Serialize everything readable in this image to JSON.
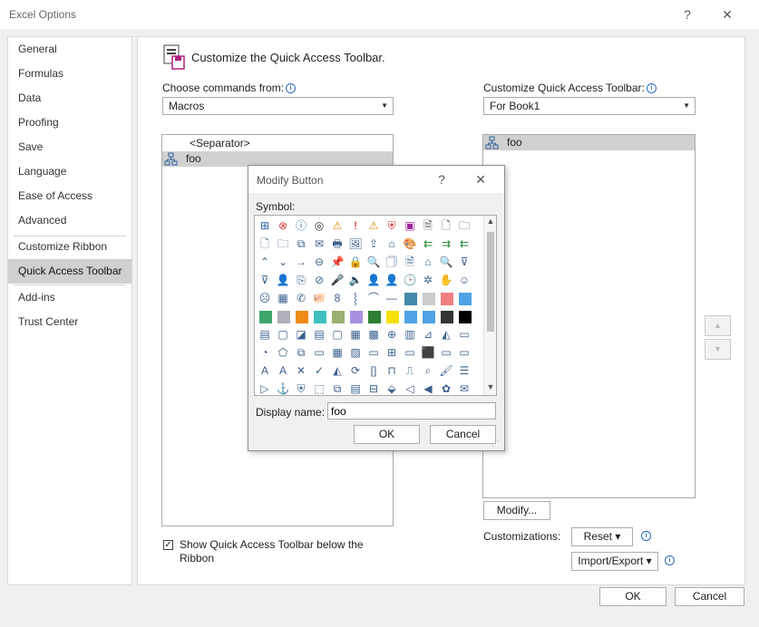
{
  "window": {
    "title": "Excel Options",
    "help_glyph": "?",
    "close_glyph": "✕"
  },
  "nav": {
    "items": [
      {
        "label": "General"
      },
      {
        "label": "Formulas"
      },
      {
        "label": "Data"
      },
      {
        "label": "Proofing"
      },
      {
        "label": "Save"
      },
      {
        "label": "Language"
      },
      {
        "label": "Ease of Access"
      },
      {
        "label": "Advanced"
      },
      {
        "label": "Customize Ribbon"
      },
      {
        "label": "Quick Access Toolbar",
        "selected": true
      },
      {
        "label": "Add-ins"
      },
      {
        "label": "Trust Center"
      }
    ]
  },
  "main": {
    "heading": "Customize the Quick Access Toolbar.",
    "choose_label": "Choose commands from:",
    "choose_value": "Macros",
    "customize_label": "Customize Quick Access Toolbar:",
    "customize_value": "For Book1",
    "commands": [
      {
        "label": "<Separator>",
        "icon": ""
      },
      {
        "label": "foo",
        "icon": "macro-icon",
        "selected": true
      }
    ],
    "toolbar_items": [
      {
        "label": "foo",
        "icon": "macro-icon",
        "selected": true
      }
    ],
    "modify_button": "Modify...",
    "customizations_label": "Customizations:",
    "reset_button": "Reset ▾",
    "import_export_button": "Import/Export ▾",
    "show_below_label_1": "Show Quick Access Toolbar below the",
    "show_below_label_2": "Ribbon",
    "show_below_checked": true,
    "move_up_glyph": "▲",
    "move_down_glyph": "▼"
  },
  "footer": {
    "ok": "OK",
    "cancel": "Cancel"
  },
  "modal": {
    "title": "Modify Button",
    "help_glyph": "?",
    "close_glyph": "✕",
    "symbol_label": "Symbol:",
    "display_name_label": "Display name:",
    "display_name_value": "foo",
    "ok": "OK",
    "cancel": "Cancel",
    "symbols": [
      "⊞",
      "⊗",
      "ⓘ",
      "◎",
      "⚠",
      "!",
      "⚠",
      "⛨",
      "▣",
      "🗎",
      "🗋",
      "🗀",
      "🗋",
      "🗀",
      "⧉",
      "✉",
      "🖶",
      "🖼",
      "⇪",
      "⌂",
      "🎨",
      "⇇",
      "⇉",
      "⇇",
      "⌃",
      "⌄",
      "→",
      "⊖",
      "📌",
      "🔒",
      "🔍",
      "🗍",
      "🗎",
      "⌂",
      "🔍",
      "⊽",
      "⊽",
      "👤",
      "⎘",
      "⊘",
      "🎤",
      "🔈",
      "👤",
      "👤",
      "🕒",
      "✲",
      "✋",
      "☺",
      "☹",
      "▦",
      "✆",
      "🐖",
      "8",
      "⸾",
      "⌒",
      "—",
      "#48a",
      "#ccc",
      "#f08080",
      "#4da3e6",
      "#3fa66b",
      "#b0b0b8",
      "#f08b17",
      "#3fbfbf",
      "#9bb070",
      "#a890e0",
      "#2e7d32",
      "#f5e000",
      "#4da3e6",
      "#4da3e6",
      "#333",
      "#000",
      "▤",
      "▢",
      "◪",
      "▤",
      "▢",
      "▦",
      "▩",
      "⊕",
      "▥",
      "⊿",
      "◭",
      "▭",
      "◔",
      "⬠",
      "⧉",
      "▭",
      "▦",
      "▨",
      "▭",
      "⊞",
      "▭",
      "⬛",
      "▭",
      "▭",
      "A",
      "A",
      "✕",
      "✓",
      "◭",
      "⟳",
      "[]",
      "⊓",
      "⎍",
      "⌕",
      "🖌",
      "☰",
      "▷",
      "⚓",
      "⛨",
      "⬚",
      "⧉",
      "▤",
      "⊟",
      "⬙",
      "◁",
      "◀",
      "✿",
      "✉"
    ]
  }
}
